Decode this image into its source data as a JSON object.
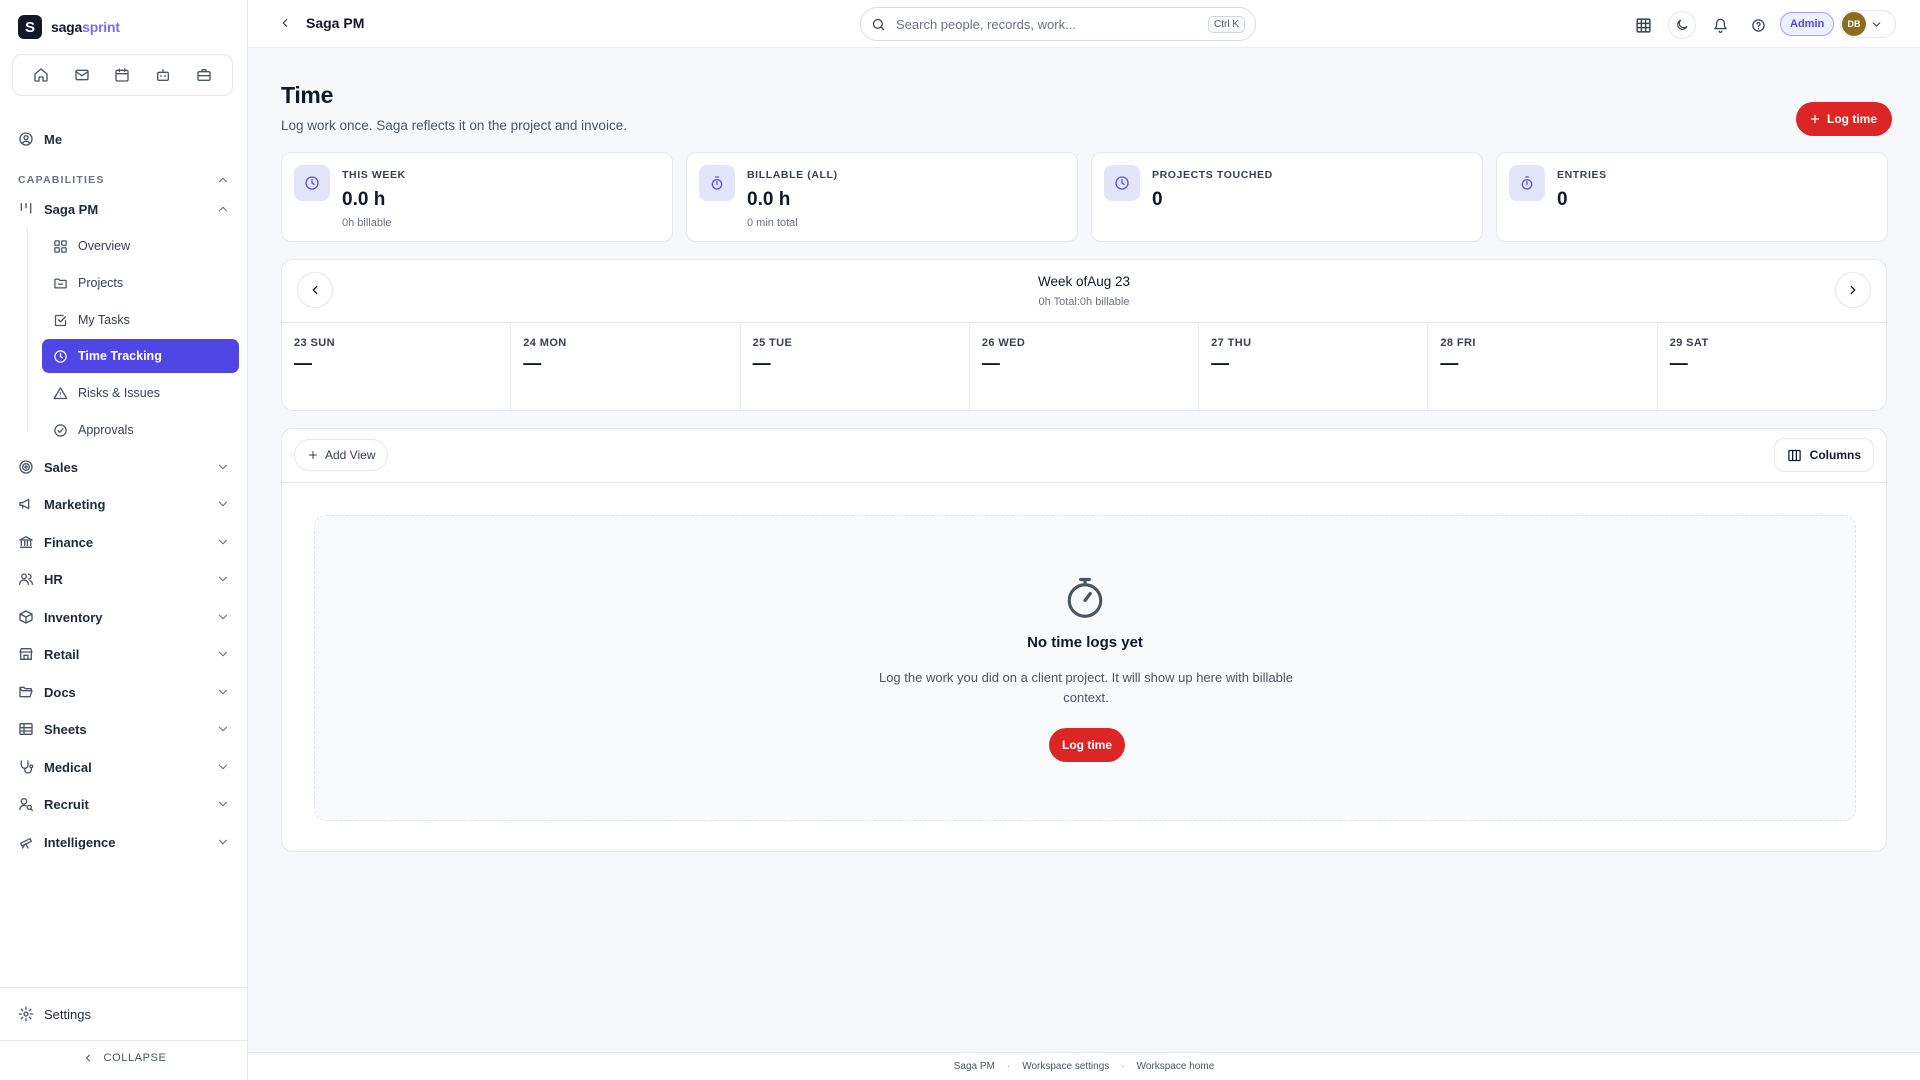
{
  "brand": {
    "mark": "S",
    "name_part1": "saga",
    "name_part2": "sprint"
  },
  "quick_icons": [
    "home-icon",
    "mail-icon",
    "calendar-icon",
    "bot-icon",
    "briefcase-icon"
  ],
  "sidebar": {
    "me_label": "Me",
    "capabilities_label": "CAPABILITIES",
    "current_group": "Saga PM",
    "sub_items": [
      {
        "label": "Overview",
        "icon": "grid-icon"
      },
      {
        "label": "Projects",
        "icon": "folder-icon"
      },
      {
        "label": "My Tasks",
        "icon": "check-square-icon"
      },
      {
        "label": "Time Tracking",
        "icon": "clock-icon",
        "active": true
      },
      {
        "label": "Risks & Issues",
        "icon": "alert-triangle-icon"
      },
      {
        "label": "Approvals",
        "icon": "check-circle-icon"
      }
    ],
    "groups": [
      {
        "label": "Sales",
        "icon": "target-icon"
      },
      {
        "label": "Marketing",
        "icon": "megaphone-icon"
      },
      {
        "label": "Finance",
        "icon": "bank-icon"
      },
      {
        "label": "HR",
        "icon": "users-icon"
      },
      {
        "label": "Inventory",
        "icon": "box-icon"
      },
      {
        "label": "Retail",
        "icon": "store-icon"
      },
      {
        "label": "Docs",
        "icon": "folder-open-icon"
      },
      {
        "label": "Sheets",
        "icon": "table-icon"
      },
      {
        "label": "Medical",
        "icon": "stethoscope-icon"
      },
      {
        "label": "Recruit",
        "icon": "user-search-icon"
      },
      {
        "label": "Intelligence",
        "icon": "telescope-icon"
      }
    ],
    "settings_label": "Settings",
    "collapse_label": "COLLAPSE"
  },
  "topbar": {
    "breadcrumb": "Saga PM",
    "search_placeholder": "Search people, records, work...",
    "shortcut": "Ctrl K",
    "role_badge": "Admin",
    "avatar_initials": "DB"
  },
  "page": {
    "title": "Time",
    "subtitle": "Log work once. Saga reflects it on the project and invoice.",
    "log_time_label": "Log time"
  },
  "stats": [
    {
      "label": "THIS WEEK",
      "value": "0.0 h",
      "foot": "0h billable",
      "icon": "clock-icon"
    },
    {
      "label": "BILLABLE (ALL)",
      "value": "0.0 h",
      "foot": "0 min total",
      "icon": "stopwatch-icon"
    },
    {
      "label": "PROJECTS TOUCHED",
      "value": "0",
      "foot": "",
      "icon": "clock-icon"
    },
    {
      "label": "ENTRIES",
      "value": "0",
      "foot": "",
      "icon": "stopwatch-icon"
    }
  ],
  "week": {
    "title": "Week ofAug 23",
    "summary": "0h Total:0h billable",
    "days": [
      {
        "name": "23 SUN",
        "value": "—"
      },
      {
        "name": "24 MON",
        "value": "—"
      },
      {
        "name": "25 TUE",
        "value": "—"
      },
      {
        "name": "26 WED",
        "value": "—"
      },
      {
        "name": "27 THU",
        "value": "—"
      },
      {
        "name": "28 FRI",
        "value": "—"
      },
      {
        "name": "29 SAT",
        "value": "—"
      }
    ]
  },
  "logs": {
    "add_view_label": "Add View",
    "columns_label": "Columns",
    "empty_title": "No time logs yet",
    "empty_desc": "Log the work you did on a client project. It will show up here with billable context.",
    "empty_button": "Log time"
  },
  "footer": {
    "links": [
      "Saga PM",
      "Workspace settings",
      "Workspace home"
    ]
  },
  "colors": {
    "accent": "#4f46e5",
    "danger": "#dc2626",
    "brand_accent": "#7c6cf2"
  }
}
